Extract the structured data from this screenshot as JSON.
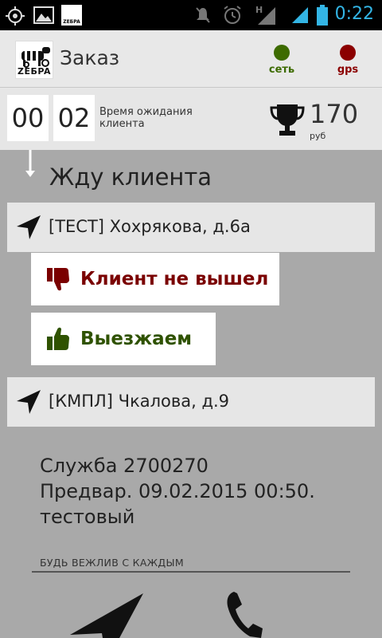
{
  "statusbar": {
    "time": "0:22",
    "icons": [
      "gps-icon",
      "image-icon",
      "zebra-app-icon",
      "mute-icon",
      "alarm-icon",
      "hspa-signal-icon",
      "signal-icon",
      "battery-icon"
    ],
    "notif_logo_text": "ZEБPA"
  },
  "actionbar": {
    "logo_text": "ZEБPA",
    "title": "Заказ",
    "network_label": "сеть",
    "network_color": "#3d6b00",
    "gps_label": "gps",
    "gps_color": "#8b0000"
  },
  "timer": {
    "minutes_tens": "00",
    "minutes": "02",
    "label": "Время ожидания клиента",
    "cost": "170",
    "currency": "руб"
  },
  "status": {
    "title": "Жду клиента"
  },
  "route": {
    "from": "[ТЕСТ] Хохрякова, д.6а",
    "to": "[КМПЛ] Чкалова, д.9"
  },
  "actions": {
    "no_show_label": "Клиент не вышел",
    "no_show_color": "#7a0000",
    "depart_label": "Выезжаем",
    "depart_color": "#2f5200"
  },
  "info": {
    "service": "Служба 2700270",
    "preorder": "Предвар. 09.02.2015 00:50.",
    "comment": "тестовый"
  },
  "hint": {
    "label": "БУДЬ ВЕЖЛИВ С КАЖДЫМ"
  }
}
